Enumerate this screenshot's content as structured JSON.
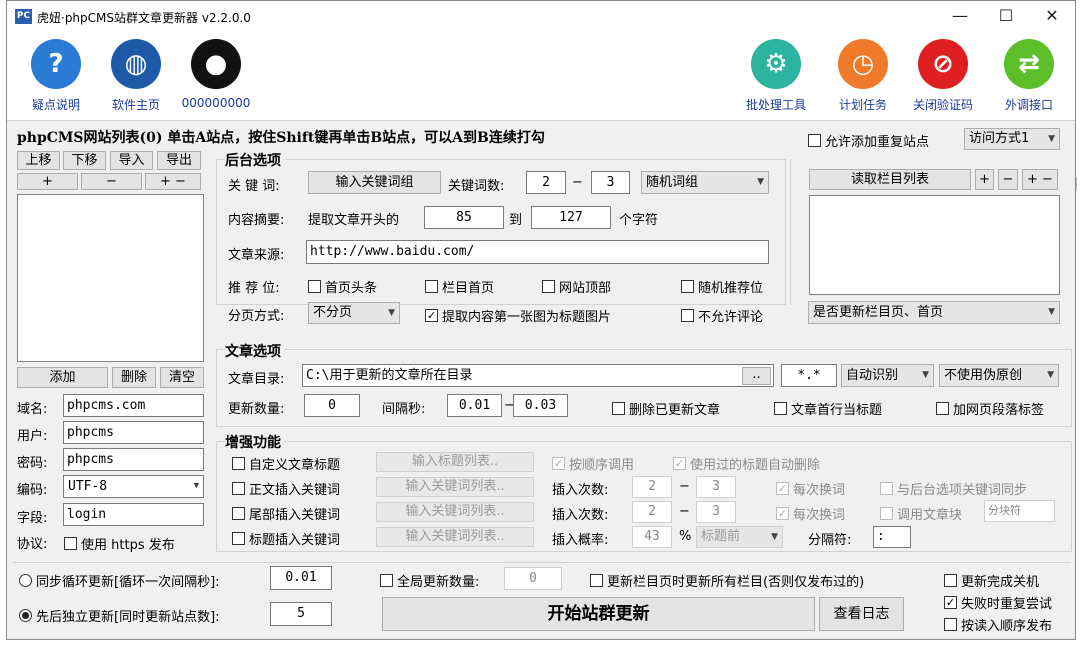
{
  "window": {
    "title": "虎妞·phpCMS站群文章更新器 v2.2.0.0",
    "icon_text": "PC",
    "min": "—",
    "max": "☐",
    "close": "✕"
  },
  "toolbar": {
    "left": [
      {
        "label": "疑点说明",
        "icon": "help-icon",
        "color": "#2a7bd6",
        "glyph": "?"
      },
      {
        "label": "软件主页",
        "icon": "globe-icon",
        "color": "#1e5aa8",
        "glyph": "◍"
      },
      {
        "label": "000000000",
        "icon": "qq-penguin-icon",
        "color": "#111111",
        "glyph": "●"
      }
    ],
    "right": [
      {
        "label": "批处理工具",
        "icon": "gear-icon",
        "color": "#2bb5a0",
        "glyph": "⚙"
      },
      {
        "label": "计划任务",
        "icon": "clock-icon",
        "color": "#f07a2a",
        "glyph": "◷"
      },
      {
        "label": "关闭验证码",
        "icon": "no-entry-icon",
        "color": "#e02020",
        "glyph": "⊘"
      },
      {
        "label": "外调接口",
        "icon": "exchange-icon",
        "color": "#5cbf2a",
        "glyph": "⇄"
      }
    ]
  },
  "site_list": {
    "header": "phpCMS网站列表(0)  单击A站点，按住Shift键再单击B站点，可以A到B连续打勾",
    "allow_dup": "允许添加重复站点",
    "access_mode": "访问方式1",
    "btn_up": "上移",
    "btn_down": "下移",
    "btn_import": "导入",
    "btn_export": "导出",
    "btn_plus": "+",
    "btn_minus": "−",
    "btn_plusminus": "+ −",
    "btn_add": "添加",
    "btn_delete": "删除",
    "btn_clear": "清空",
    "domain_label": "域名:",
    "domain": "phpcms.com",
    "user_label": "用户:",
    "user": "phpcms",
    "pass_label": "密码:",
    "pass": "phpcms",
    "enc_label": "编码:",
    "enc": "UTF-8",
    "field_label": "字段:",
    "field": "login",
    "proto_label": "协议:",
    "proto": "使用 https 发布"
  },
  "backend": {
    "title": "后台选项",
    "kw_label": "关 键 词:",
    "kw_btn": "输入关键词组",
    "kwcount_label": "关键词数:",
    "kw_min": "2",
    "kw_max": "3",
    "dash": "−",
    "kw_mode": "随机词组",
    "summary_label": "内容摘要:",
    "summary_text": "提取文章开头的",
    "sum_from": "85",
    "to": "到",
    "sum_to": "127",
    "chars": "个字符",
    "source_label": "文章来源:",
    "source": "http://www.baidu.com/",
    "recommend_label": "推 荐 位:",
    "rec1": "首页头条",
    "rec2": "栏目首页",
    "rec3": "网站顶部",
    "rec4": "随机推荐位",
    "page_label": "分页方式:",
    "page_mode": "不分页",
    "first_img": "提取内容第一张图为标题图片",
    "no_comment": "不允许评论",
    "read_cols": "读取栏目列表",
    "col_plus": "+",
    "col_minus": "−",
    "col_pm": "+ −",
    "update_cols": "是否更新栏目页、首页"
  },
  "article": {
    "title": "文章选项",
    "dir_label": "文章目录:",
    "dir": "C:\\用于更新的文章所在目录",
    "browse": "..",
    "ext": "*.*",
    "encode": "自动识别",
    "pseudo": "不使用伪原创",
    "count_label": "更新数量:",
    "count": "0",
    "interval_label": "间隔秒:",
    "int_from": "0.01",
    "int_to": "0.03",
    "del_updated": "删除已更新文章",
    "first_line": "文章首行当标题",
    "add_tag": "加网页段落标签"
  },
  "enhance": {
    "title": "增强功能",
    "custom_title": "自定义文章标题",
    "title_list_btn": "输入标题列表..",
    "seq_call": "按顺序调用",
    "auto_del": "使用过的标题自动删除",
    "body_kw": "正文插入关键词",
    "kw_list_btn": "输入关键词列表..",
    "ins_count_label": "插入次数:",
    "ins1_from": "2",
    "ins1_to": "3",
    "each_change": "每次换词",
    "sync_kw": "与后台选项关键词同步",
    "tail_kw": "尾部插入关键词",
    "ins2_from": "2",
    "ins2_to": "3",
    "call_block": "调用文章块",
    "block_sep": "分块符",
    "title_kw": "标题插入关键词",
    "prob_label": "插入概率:",
    "prob": "43",
    "pct": "%",
    "pos": "标题前",
    "separator_label": "分隔符:",
    "separator": ":"
  },
  "bottom": {
    "sync_loop": "同步循环更新[循环一次间隔秒]:",
    "sync_val": "0.01",
    "global_count": "全局更新数量:",
    "global_val": "0",
    "update_all_cols": "更新栏目页时更新所有栏目(否则仅发布过的)",
    "shutdown": "更新完成关机",
    "parallel": "先后独立更新[同时更新站点数]:",
    "parallel_val": "5",
    "start": "开始站群更新",
    "log": "查看日志",
    "retry": "失败时重复尝试",
    "order_publish": "按读入顺序发布"
  },
  "colors": {
    "window_bg": "#f0f0f0",
    "link": "#1a3c9c"
  }
}
